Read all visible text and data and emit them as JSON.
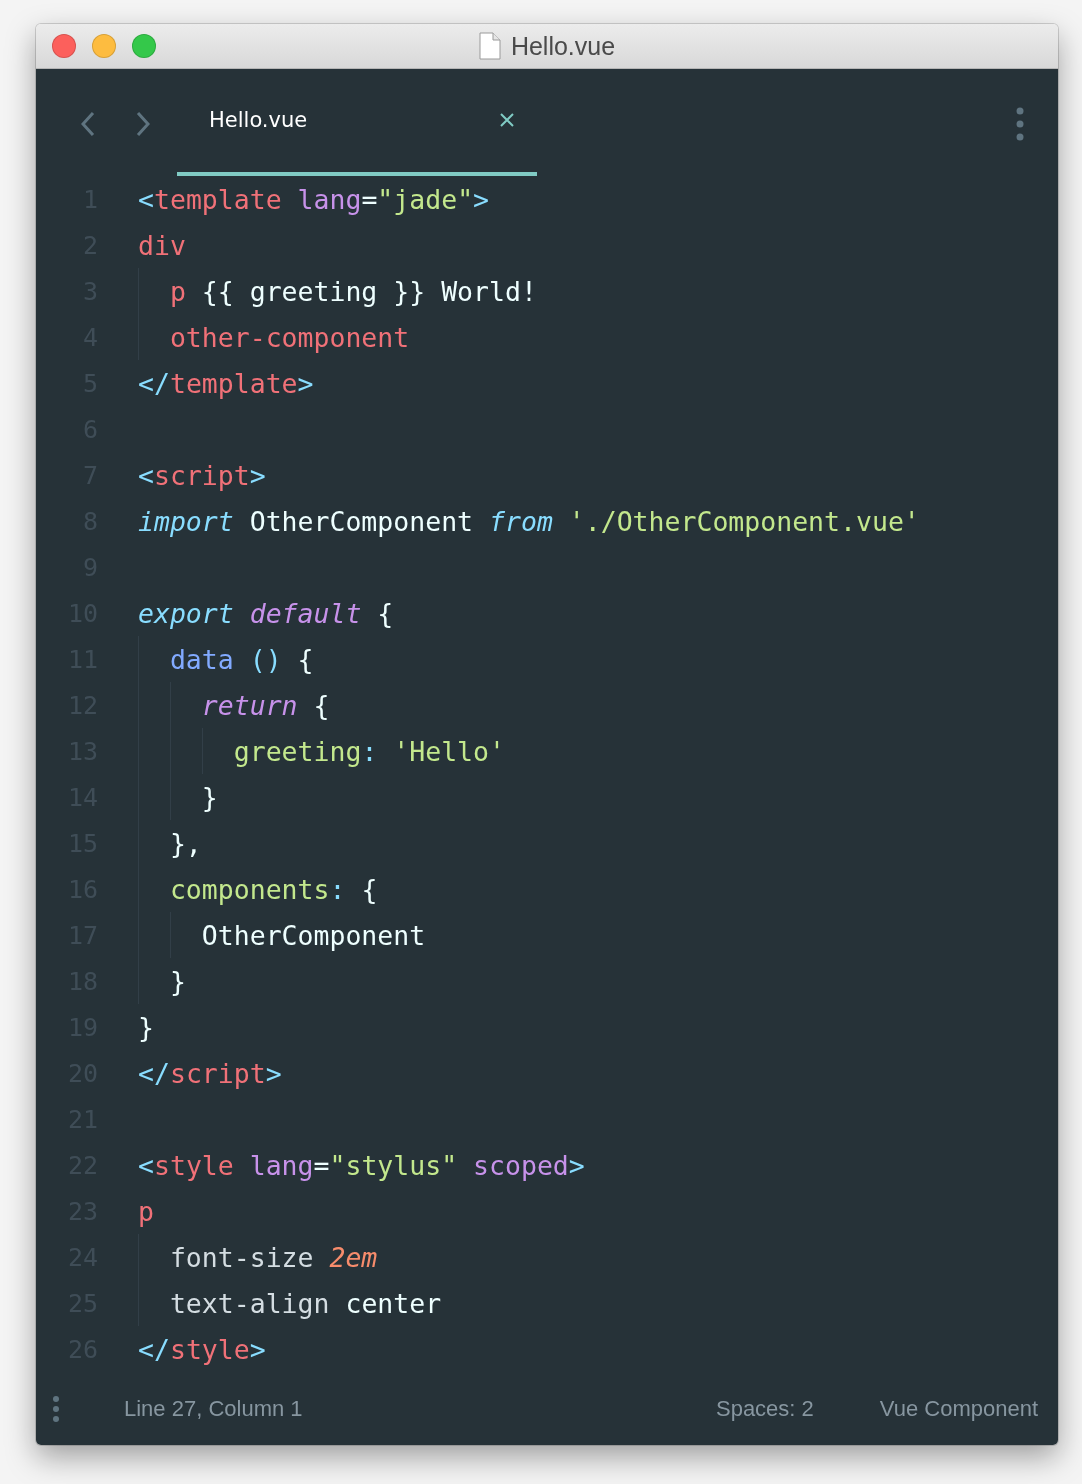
{
  "window": {
    "title": "Hello.vue"
  },
  "tabs": [
    {
      "label": "Hello.vue",
      "selected": true
    }
  ],
  "code_lines": [
    {
      "number": "1",
      "tokens": [
        {
          "kind": "punct",
          "text": "<"
        },
        {
          "kind": "tag",
          "text": "template "
        },
        {
          "kind": "attr",
          "text": "lang"
        },
        {
          "kind": "text",
          "text": "="
        },
        {
          "kind": "string",
          "text": "\"jade\""
        },
        {
          "kind": "punct",
          "text": ">"
        }
      ]
    },
    {
      "number": "2",
      "tokens": [
        {
          "kind": "tag",
          "text": "div"
        }
      ]
    },
    {
      "number": "3",
      "tokens": [
        {
          "kind": "tag",
          "text": "  p "
        },
        {
          "kind": "text",
          "text": "{{ greeting }} World!"
        }
      ]
    },
    {
      "number": "4",
      "tokens": [
        {
          "kind": "tag",
          "text": "  other-component"
        }
      ]
    },
    {
      "number": "5",
      "tokens": [
        {
          "kind": "punct",
          "text": "</"
        },
        {
          "kind": "tag",
          "text": "template"
        },
        {
          "kind": "punct",
          "text": ">"
        }
      ]
    },
    {
      "number": "6"
    },
    {
      "number": "7",
      "tokens": [
        {
          "kind": "punct",
          "text": "<"
        },
        {
          "kind": "tag",
          "text": "script"
        },
        {
          "kind": "punct",
          "text": ">"
        }
      ]
    },
    {
      "number": "8",
      "tokens": [
        {
          "kind": "keyword",
          "text": "import "
        },
        {
          "kind": "text",
          "text": "OtherComponent "
        },
        {
          "kind": "keyword",
          "text": "from "
        },
        {
          "kind": "string",
          "text": "'./OtherComponent.vue'"
        }
      ]
    },
    {
      "number": "9"
    },
    {
      "number": "10",
      "tokens": [
        {
          "kind": "keyword",
          "text": "export "
        },
        {
          "kind": "keyword2",
          "text": "default "
        },
        {
          "kind": "text",
          "text": "{"
        }
      ]
    },
    {
      "number": "11",
      "tokens": [
        {
          "kind": "func",
          "text": "  data "
        },
        {
          "kind": "punct",
          "text": "() "
        },
        {
          "kind": "text",
          "text": "{"
        }
      ]
    },
    {
      "number": "12",
      "tokens": [
        {
          "kind": "keyword2",
          "text": "    return "
        },
        {
          "kind": "text",
          "text": "{"
        }
      ]
    },
    {
      "number": "13",
      "tokens": [
        {
          "kind": "prop",
          "text": "      greeting"
        },
        {
          "kind": "punct",
          "text": ": "
        },
        {
          "kind": "string",
          "text": "'Hello'"
        }
      ]
    },
    {
      "number": "14",
      "tokens": [
        {
          "kind": "text",
          "text": "    }"
        }
      ]
    },
    {
      "number": "15",
      "tokens": [
        {
          "kind": "text",
          "text": "  },"
        }
      ]
    },
    {
      "number": "16",
      "tokens": [
        {
          "kind": "prop",
          "text": "  components"
        },
        {
          "kind": "punct",
          "text": ": "
        },
        {
          "kind": "text",
          "text": "{"
        }
      ]
    },
    {
      "number": "17",
      "tokens": [
        {
          "kind": "text",
          "text": "    OtherComponent"
        }
      ]
    },
    {
      "number": "18",
      "tokens": [
        {
          "kind": "text",
          "text": "  }"
        }
      ]
    },
    {
      "number": "19",
      "tokens": [
        {
          "kind": "text",
          "text": "}"
        }
      ]
    },
    {
      "number": "20",
      "tokens": [
        {
          "kind": "punct",
          "text": "</"
        },
        {
          "kind": "tag",
          "text": "script"
        },
        {
          "kind": "punct",
          "text": ">"
        }
      ]
    },
    {
      "number": "21"
    },
    {
      "number": "22",
      "tokens": [
        {
          "kind": "punct",
          "text": "<"
        },
        {
          "kind": "tag",
          "text": "style "
        },
        {
          "kind": "attr",
          "text": "lang"
        },
        {
          "kind": "text",
          "text": "="
        },
        {
          "kind": "string",
          "text": "\"stylus\" "
        },
        {
          "kind": "attr",
          "text": "scoped"
        },
        {
          "kind": "punct",
          "text": ">"
        }
      ]
    },
    {
      "number": "23",
      "tokens": [
        {
          "kind": "tag",
          "text": "p"
        }
      ]
    },
    {
      "number": "24",
      "tokens": [
        {
          "kind": "plainprop",
          "text": "  font-size "
        },
        {
          "kind": "number",
          "text": "2em"
        }
      ]
    },
    {
      "number": "25",
      "tokens": [
        {
          "kind": "plainprop",
          "text": "  text-align "
        },
        {
          "kind": "text",
          "text": "center"
        }
      ]
    },
    {
      "number": "26",
      "tokens": [
        {
          "kind": "punct",
          "text": "</"
        },
        {
          "kind": "tag",
          "text": "style"
        },
        {
          "kind": "punct",
          "text": ">"
        }
      ]
    }
  ],
  "status_bar": {
    "position": "Line 27, Column 1",
    "indentation": "Spaces: 2",
    "syntax": "Vue Component"
  }
}
